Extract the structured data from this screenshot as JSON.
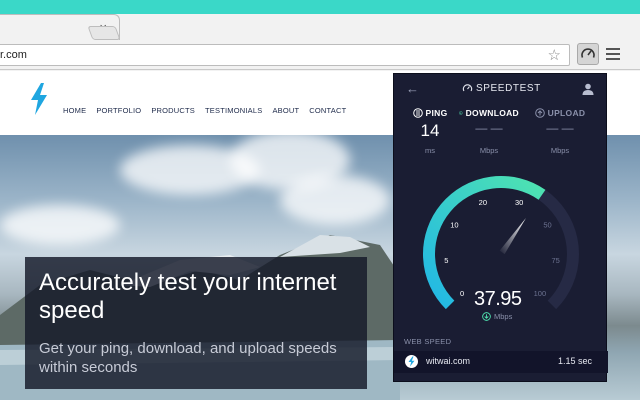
{
  "browser": {
    "tab_close": "×",
    "url": "r.com",
    "star": "☆"
  },
  "site": {
    "nav": [
      "HOME",
      "PORTFOLIO",
      "PRODUCTS",
      "TESTIMONIALS",
      "ABOUT",
      "CONTACT"
    ],
    "hero_title": "Accurately test your internet speed",
    "hero_subtitle": "Get your ping, download, and upload speeds within seconds"
  },
  "speedtest": {
    "title": "SPEEDTEST",
    "back": "←",
    "ping": {
      "label": "PING",
      "value": "14",
      "unit": "ms"
    },
    "download": {
      "label": "DOWNLOAD",
      "value": "— —",
      "unit": "Mbps"
    },
    "upload": {
      "label": "UPLOAD",
      "value": "— —",
      "unit": "Mbps"
    },
    "gauge": {
      "ticks": [
        "0",
        "5",
        "10",
        "20",
        "30",
        "50",
        "75",
        "100"
      ],
      "max_tick_index": 7,
      "current_value": 37.95,
      "needle_tick_position": 4.4
    },
    "speed_value": "37.95",
    "speed_unit": "Mbps",
    "web_speed_label": "WEB SPEED",
    "web_host": "witwai.com",
    "web_time": "1.15 sec"
  },
  "colors": {
    "accent_teal": "#3ad8c8",
    "gauge_start": "#21b7e6",
    "gauge_end": "#4fe3b0",
    "popup_bg": "#1a1d33",
    "logo_blue": "#1fa6e0"
  }
}
